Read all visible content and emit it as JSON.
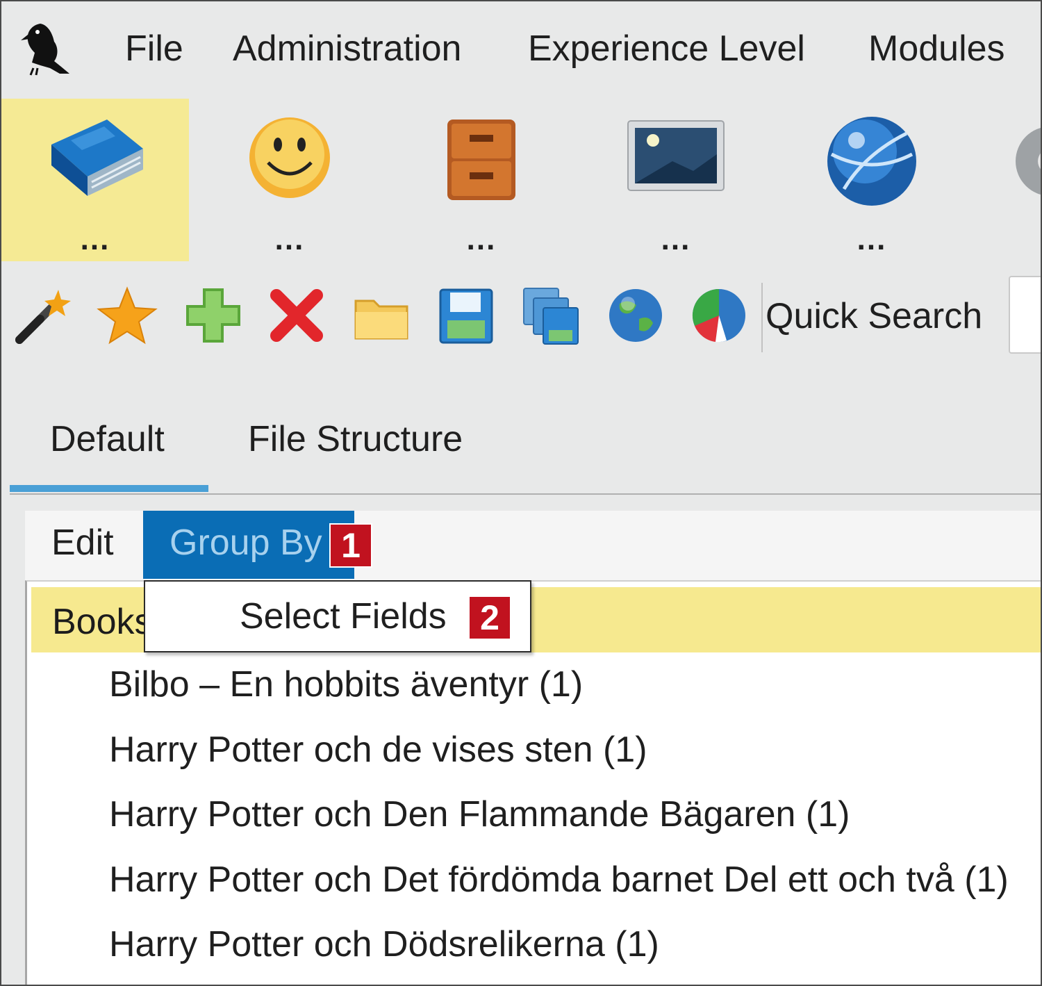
{
  "menu": {
    "file": "File",
    "administration": "Administration",
    "experience_level": "Experience Level",
    "modules": "Modules"
  },
  "modules": [
    {
      "icon": "book-icon",
      "label": "...",
      "active": true
    },
    {
      "icon": "smiley-icon",
      "label": "..."
    },
    {
      "icon": "cabinet-icon",
      "label": "..."
    },
    {
      "icon": "picture-icon",
      "label": "..."
    },
    {
      "icon": "globe-icon",
      "label": "..."
    }
  ],
  "toolbar": {
    "icons": [
      "magic-wand-icon",
      "star-icon",
      "add-icon",
      "delete-icon",
      "folder-icon",
      "save-icon",
      "save-copy-icon",
      "globe-icon",
      "chart-icon"
    ],
    "quick_search_label": "Quick Search"
  },
  "tabs": {
    "default": "Default",
    "file_structure": "File Structure"
  },
  "content_menu": {
    "edit": "Edit",
    "group_by": "Group By",
    "badge1": "1"
  },
  "dropdown": {
    "select_fields": "Select Fields",
    "badge2": "2"
  },
  "tree": {
    "group_label": "Books",
    "items": [
      "Bilbo – En hobbits äventyr (1)",
      "Harry Potter och de vises sten (1)",
      "Harry Potter och Den Flammande Bägaren (1)",
      "Harry Potter och Det fördömda barnet Del ett och två (1)",
      "Harry Potter och Dödsrelikerna (1)"
    ]
  },
  "colors": {
    "selected_menu": "#0a6db5",
    "highlight_yellow": "#f6e98f",
    "badge_red": "#c1121f",
    "tab_underline": "#4aa0d6"
  }
}
